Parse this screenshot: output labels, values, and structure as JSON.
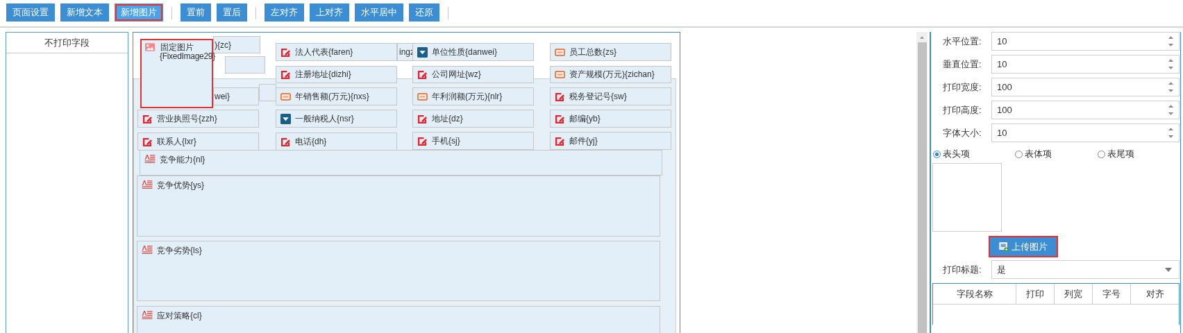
{
  "toolbar": {
    "groups": [
      [
        {
          "label": "页面设置",
          "highlighted": false
        },
        {
          "label": "新增文本",
          "highlighted": false
        },
        {
          "label": "新增图片",
          "highlighted": true
        }
      ],
      [
        {
          "label": "置前",
          "highlighted": false
        },
        {
          "label": "置后",
          "highlighted": false
        }
      ],
      [
        {
          "label": "左对齐",
          "highlighted": false
        },
        {
          "label": "上对齐",
          "highlighted": false
        },
        {
          "label": "水平居中",
          "highlighted": false
        },
        {
          "label": "还原",
          "highlighted": false
        }
      ]
    ]
  },
  "hidden_fields_panel": {
    "title": "不打印字段"
  },
  "canvas": {
    "fields": [
      {
        "kind": "partial",
        "label": "){zc}"
      },
      {
        "kind": "edit",
        "label": "法人代表{faren}"
      },
      {
        "kind": "partial",
        "label": "ingz"
      },
      {
        "kind": "dropdown",
        "label": "单位性质{danwei}"
      },
      {
        "kind": "number",
        "label": "员工总数{zs}"
      },
      {
        "kind": "edit",
        "label": "注册地址{dizhi}"
      },
      {
        "kind": "edit",
        "label": "公司网址{wz}"
      },
      {
        "kind": "number",
        "label": "资产规模(万元){zichan}"
      },
      {
        "kind": "partial",
        "label": "wei}"
      },
      {
        "kind": "number",
        "label": "年销售额(万元){nxs}"
      },
      {
        "kind": "number",
        "label": "年利润额(万元){nlr}"
      },
      {
        "kind": "edit",
        "label": "税务登记号{sw}"
      },
      {
        "kind": "edit",
        "label": "营业执照号{zzh}"
      },
      {
        "kind": "dropdown",
        "label": "一般纳税人{nsr}"
      },
      {
        "kind": "edit",
        "label": "地址{dz}"
      },
      {
        "kind": "edit",
        "label": "邮编{yb}"
      },
      {
        "kind": "edit",
        "label": "联系人{lxr}"
      },
      {
        "kind": "edit",
        "label": "电话{dh}"
      },
      {
        "kind": "edit",
        "label": "手机{sj}"
      },
      {
        "kind": "edit",
        "label": "邮件{yj}"
      },
      {
        "kind": "area",
        "label": "竞争能力{nl}"
      },
      {
        "kind": "area",
        "label": "竞争优势{ys}"
      },
      {
        "kind": "area",
        "label": "竞争劣势{ls}"
      },
      {
        "kind": "area",
        "label": "应对策略{cl}"
      }
    ],
    "image": {
      "title": "固定图片",
      "name": "{FixedImage29}",
      "highlighted": true
    }
  },
  "properties": {
    "rows": [
      {
        "label": "水平位置:",
        "value": "10"
      },
      {
        "label": "垂直位置:",
        "value": "10"
      },
      {
        "label": "打印宽度:",
        "value": "100"
      },
      {
        "label": "打印高度:",
        "value": "100"
      },
      {
        "label": "字体大小:",
        "value": "10"
      }
    ],
    "sections": [
      {
        "label": "表头项",
        "selected": true
      },
      {
        "label": "表体项",
        "selected": false
      },
      {
        "label": "表尾项",
        "selected": false
      }
    ],
    "upload_button": {
      "label": "上传图片",
      "highlighted": true
    },
    "print_title": {
      "label": "打印标题:",
      "value": "是"
    },
    "table": {
      "columns": [
        "字段名称",
        "打印",
        "列宽",
        "字号",
        "对齐"
      ]
    }
  }
}
